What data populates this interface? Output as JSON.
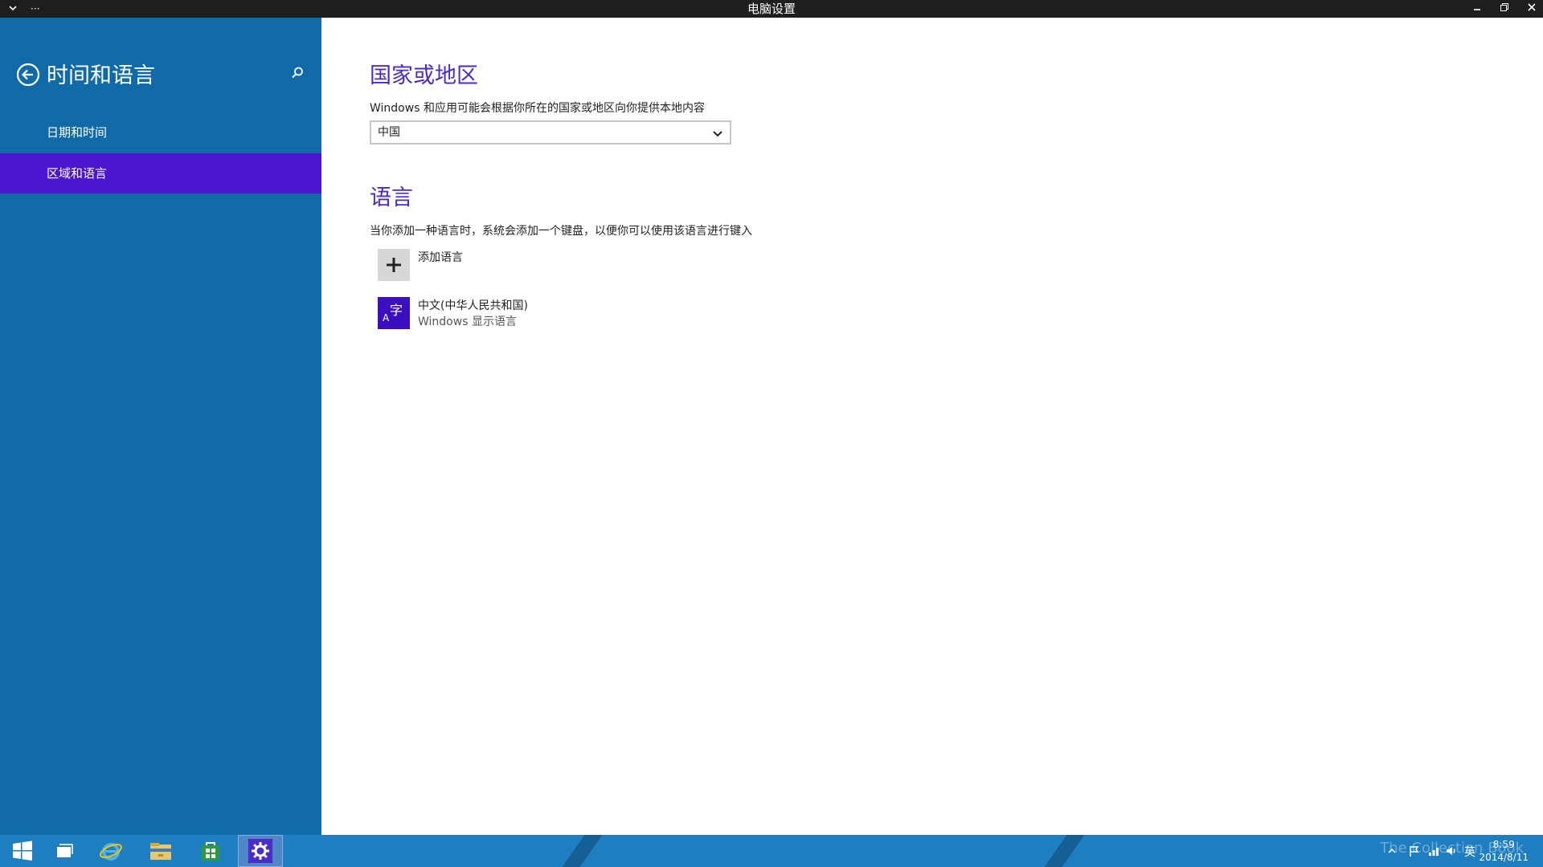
{
  "titlebar": {
    "title": "电脑设置",
    "menu_icon": "chevron-down-icon",
    "more_icon": "ellipsis-icon"
  },
  "sidebar": {
    "title": "时间和语言",
    "items": [
      {
        "label": "日期和时间",
        "selected": false
      },
      {
        "label": "区域和语言",
        "selected": true
      }
    ]
  },
  "content": {
    "region": {
      "heading": "国家或地区",
      "description": "Windows 和应用可能会根据你所在的国家或地区向你提供本地内容",
      "selected_value": "中国"
    },
    "language": {
      "heading": "语言",
      "description": "当你添加一种语言时，系统会添加一个键盘，以便你可以使用该语言进行键入",
      "add_label": "添加语言",
      "installed": [
        {
          "name": "中文(中华人民共和国)",
          "subtitle": "Windows 显示语言",
          "tile_glyph": "A字"
        }
      ]
    }
  },
  "taskbar": {
    "apps": [
      "windows-start-icon",
      "task-view-icon",
      "internet-explorer-icon",
      "file-explorer-icon",
      "store-icon",
      "settings-icon"
    ],
    "tray": {
      "ime": "英",
      "time": "8:59",
      "date": "2014/8/11",
      "watermark": "The Collection Book"
    }
  },
  "colors": {
    "sidebar": "#0f6aa7",
    "selected_nav": "#4c16cf",
    "heading": "#4a2bc9",
    "taskbar": "#1f7ec0"
  }
}
